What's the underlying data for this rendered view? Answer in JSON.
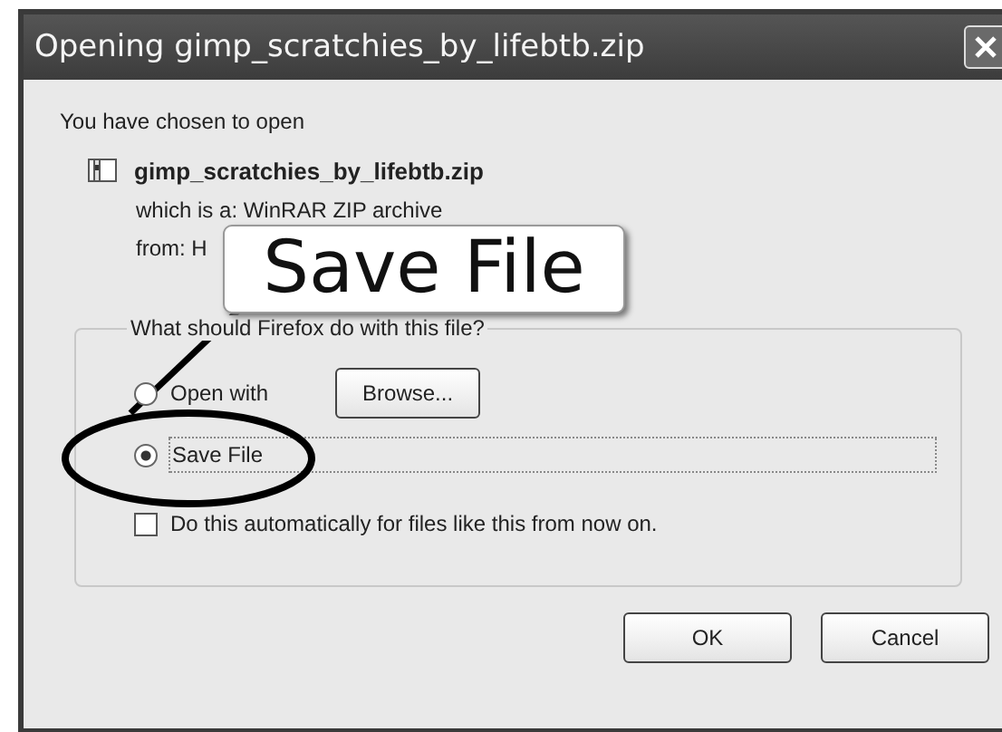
{
  "window": {
    "title": "Opening gimp_scratchies_by_lifebtb.zip"
  },
  "intro": "You have chosen to open",
  "file": {
    "name": "gimp_scratchies_by_lifebtb.zip",
    "type_line": "which is a:  WinRAR ZIP archive",
    "from_line": "from: H"
  },
  "group": {
    "legend": "What should Firefox do with this file?",
    "options": [
      {
        "kind": "radio",
        "label": "Open with",
        "selected": false,
        "button": "Browse..."
      },
      {
        "kind": "radio",
        "label": "Save File",
        "selected": true
      }
    ],
    "auto": {
      "label": "Do this automatically for files like this from now on.",
      "checked": false
    }
  },
  "buttons": [
    "OK",
    "Cancel"
  ],
  "callout": {
    "text": "Save File"
  }
}
